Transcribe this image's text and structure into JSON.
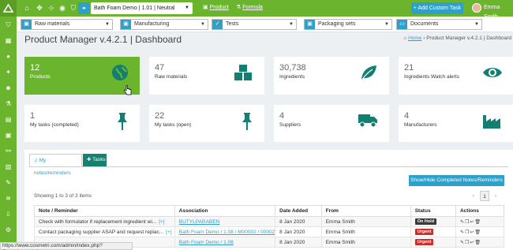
{
  "topbar": {
    "project": "Bath Foam Demo | 1.01 | Neutral (Clear)",
    "nav_product": "Product",
    "nav_formula": "Formula",
    "add_task": "Add Custom Task",
    "user_name": "Emma Smith"
  },
  "filters": [
    {
      "label": "Raw materials",
      "icon": "cubes-icon"
    },
    {
      "label": "Manufacturing",
      "icon": "cubes-icon"
    },
    {
      "label": "Tests",
      "icon": "check-circle-icon"
    },
    {
      "label": "Packaging sets",
      "icon": "cubes-icon"
    },
    {
      "label": "Documents",
      "icon": "folder-icon"
    }
  ],
  "page": {
    "title": "Product Manager v.4.2.1 | Dashboard",
    "breadcrumb_home": "Home",
    "breadcrumb_current": "Product Manager v.4.2.1 | Dashboard"
  },
  "tiles": [
    {
      "value": "12",
      "label": "Products",
      "icon": "globe-icon"
    },
    {
      "value": "47",
      "label": "Raw materials",
      "icon": "cubes-icon"
    },
    {
      "value": "30,738",
      "label": "Ingredients",
      "icon": "leaf-icon"
    },
    {
      "value": "21",
      "label": "Ingredients Watch alerts",
      "icon": "eye-icon"
    },
    {
      "value": "1",
      "label": "My tasks (completed)",
      "icon": "pin-icon"
    },
    {
      "value": "22",
      "label": "My tasks (open)",
      "icon": "pin-icon"
    },
    {
      "value": "4",
      "label": "Suppliers",
      "icon": "truck-icon"
    },
    {
      "value": "4",
      "label": "Manufacturers",
      "icon": "factory-icon"
    }
  ],
  "panel": {
    "tab_notes": "My notes/reminders",
    "tab_tasks": "Tasks",
    "show_hide_button": "Show/Hide Completed Notes/Reminders",
    "showing": "Showing 1 to 3 of 3 items",
    "page_number": "1",
    "columns": [
      "Note / Reminder",
      "Association",
      "Date Added",
      "From",
      "Status",
      "Actions"
    ],
    "rows": [
      {
        "note": "Check with formulator if replacement ingredient wi...",
        "more": "[+]",
        "association": "BUTYLPARABEN",
        "date": "8 Jan 2020",
        "from": "Emma Smith",
        "status": "On Hold",
        "status_color": "#3a3a3a"
      },
      {
        "note": "Contact packaging supplier ASAP and request replac...",
        "more": "[+]",
        "association": "Bath Foam Demo / 1.08 / M00002 / 00002",
        "date": "8 Jan 2020",
        "from": "Emma Smith",
        "status": "Urgent",
        "status_color": "#c9302c"
      },
      {
        "note": "",
        "more": "",
        "association": "Bath Foam Demo / 1.08",
        "date": "8 Jan 2020",
        "from": "Emma Smith",
        "status": "Urgent",
        "status_color": "#c9302c"
      }
    ]
  },
  "statusbar": {
    "url": "https://www.cosmetri.com/admin/index.php?files=view_products"
  },
  "colors": {
    "brand_green": "#6ab52d",
    "accent_blue": "#2fa0c8",
    "tasks_tab": "#17806e",
    "tile_icon_teal": "#137f70"
  }
}
